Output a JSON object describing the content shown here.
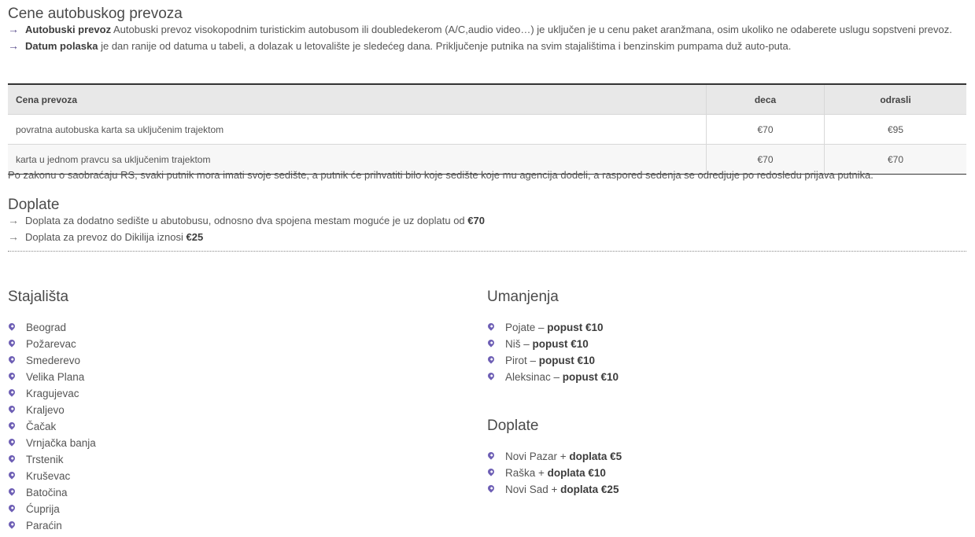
{
  "transport": {
    "title": "Cene autobuskog prevoza",
    "bullets": [
      {
        "bold": "Autobuski prevoz",
        "text": " Autobuski prevoz visokopodnim turistickim autobusom ili doubledekerom (A/C,audio video…) je uključen je u cenu paket aranžmana, osim ukoliko ne odaberete uslugu sopstveni prevoz."
      },
      {
        "bold": "Datum polaska",
        "text": " je dan ranije od datuma u tabeli, a dolazak u letovalište je sledećeg dana. Priključenje putnika na svim stajalištima i benzinskim pumpama duž auto-puta."
      }
    ]
  },
  "price_table": {
    "headers": [
      "Cena prevoza",
      "deca",
      "odrasli"
    ],
    "rows": [
      [
        "povratna autobuska karta sa uključenim trajektom",
        "€70",
        "€95"
      ],
      [
        "karta u jednom pravcu sa uključenim trajektom",
        "€70",
        "€70"
      ]
    ]
  },
  "note": "Po zakonu o saobraćaju RS, svaki putnik mora imati svoje sedište, a putnik će prihvatiti bilo koje sedište koje mu agencija dodeli, a raspored sedenja se odredjuje po redosledu prijava putnika.",
  "doplate_section": {
    "title": "Doplate",
    "items": [
      {
        "text": "Doplata za dodatno sedište u abutobusu, odnosno dva spojena mestam moguće je uz doplatu od ",
        "bold": "€70"
      },
      {
        "text": "Doplata za prevoz do Dikilija iznosi ",
        "bold": "€25"
      }
    ]
  },
  "stajalista": {
    "title": "Stajališta",
    "items": [
      "Beograd",
      "Požarevac",
      "Smederevo",
      "Velika Plana",
      "Kragujevac",
      "Kraljevo",
      "Čačak",
      "Vrnjačka banja",
      "Trstenik",
      "Kruševac",
      "Batočina",
      "Ćuprija",
      "Paraćin"
    ]
  },
  "umanjenja": {
    "title": "Umanjenja",
    "items": [
      {
        "city": "Pojate – ",
        "bold": "popust €10"
      },
      {
        "city": "Niš – ",
        "bold": "popust €10"
      },
      {
        "city": "Pirot – ",
        "bold": "popust €10"
      },
      {
        "city": "Aleksinac – ",
        "bold": "popust €10"
      }
    ]
  },
  "doplate_stops": {
    "title": "Doplate",
    "items": [
      {
        "city": "Novi Pazar + ",
        "bold": "doplata €5"
      },
      {
        "city": "Raška + ",
        "bold": "doplata €10"
      },
      {
        "city": "Novi Sad + ",
        "bold": "doplata €25"
      }
    ]
  },
  "icons": {
    "arrow": "right-arrow-icon",
    "pin": "map-pin-icon"
  },
  "colors": {
    "accent": "#6e5fb5",
    "table_header_bg": "#e8e8e8"
  }
}
